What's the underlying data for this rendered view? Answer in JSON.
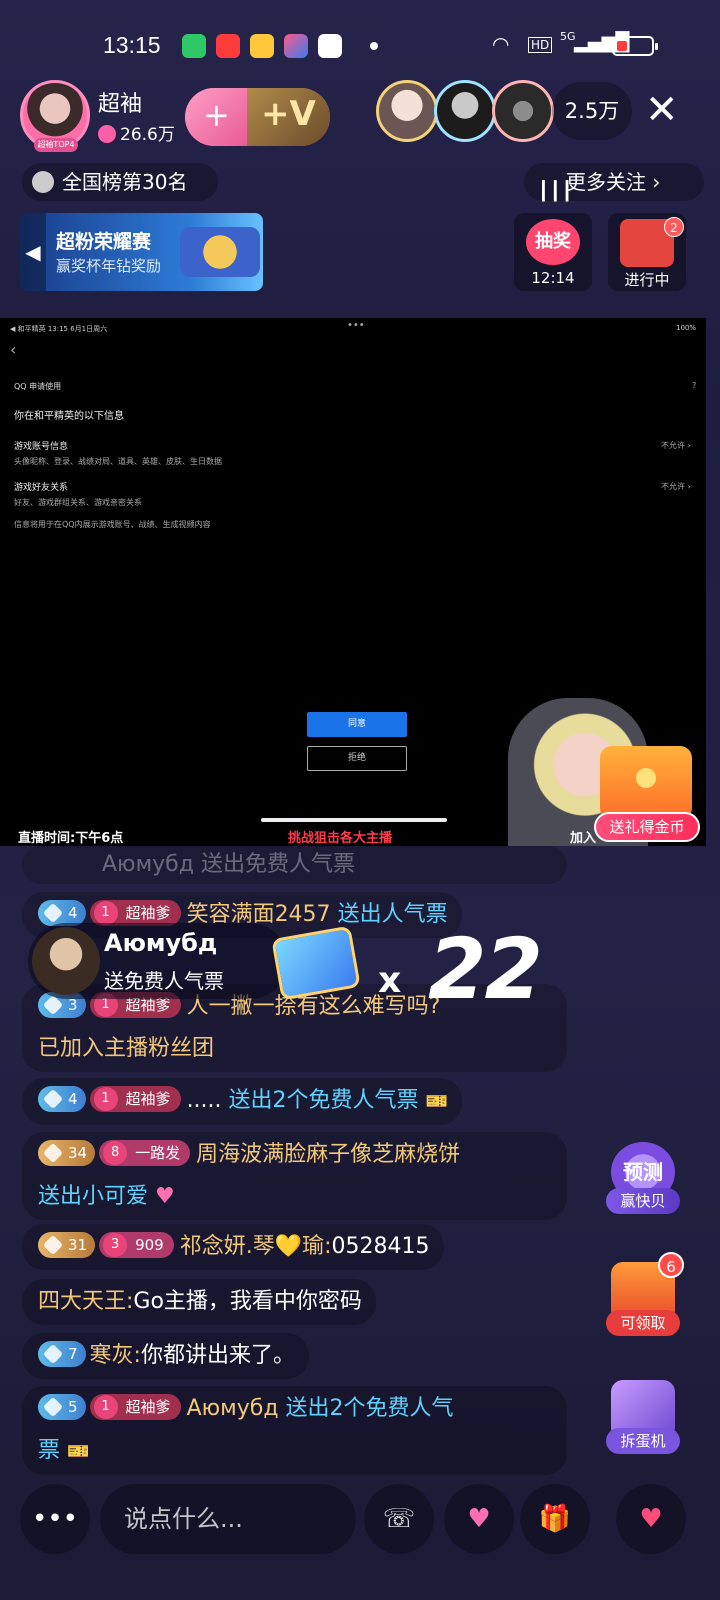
{
  "status_bar": {
    "time": "13:15",
    "hd": "HD",
    "network": "5G"
  },
  "streamer": {
    "name": "超袖",
    "likes": "26.6万",
    "avatar_tag": "超袖TOP4"
  },
  "follow_button": {
    "plus": "+",
    "v": "+V"
  },
  "viewers": {
    "count": "2.5万"
  },
  "close_label": "✕",
  "rank": {
    "label": "全国榜第30名"
  },
  "more_follow": {
    "label": "更多关注 ›"
  },
  "banner": {
    "title": "超粉荣耀赛",
    "subtitle": "赢奖杯年钻奖励",
    "arrow": "◀"
  },
  "lottery": {
    "label": "抽奖",
    "timer": "12:14"
  },
  "in_progress": {
    "label": "进行中",
    "badge": "2"
  },
  "video": {
    "status_left": "◀ 和平精英   13:15  6月1日周六",
    "status_right": "100%",
    "dots": "•••",
    "back": "‹",
    "qq_title": "QQ 申请使用",
    "qq_help": "?",
    "heading": "你在和平精英的以下信息",
    "permissions": [
      {
        "title": "游戏账号信息",
        "desc": "头像昵称、登录、战绩对局、道具、英雄、皮肤、生日数据",
        "state": "不允许 ›"
      },
      {
        "title": "游戏好友关系",
        "desc": "好友、游戏群组关系、游戏亲密关系",
        "state": "不允许 ›"
      }
    ],
    "note": "信息将用于在QQ内展示游戏账号、战绩、生成视频内容",
    "agree": "同意",
    "reject": "拒绝",
    "live_time": "直播时间:下午6点",
    "challenge": "挑战狙击各大主播",
    "join": "加入",
    "gift_coin": "送礼得金币"
  },
  "faded_msg": "Аюмубд  送出免费人气票",
  "chat": [
    {
      "level": "4",
      "fan_level": "1",
      "fan_name": "超袖爹",
      "user": "笑容满面2457",
      "action": "送出人气票",
      "text": ""
    },
    {
      "level": "3",
      "fan_level": "1",
      "fan_name": "超袖爹",
      "user": "",
      "action": "",
      "text": "人一撇一捺有这么难写吗?",
      "text2": "已加入主播粉丝团"
    },
    {
      "level": "4",
      "fan_level": "1",
      "fan_name": "超袖爹",
      "user": ".....",
      "action": "送出2个免费人气票",
      "text": ""
    },
    {
      "level": "34",
      "fan_level": "8",
      "fan_name": "一路发",
      "user": "周海波满脸麻子像芝麻烧饼",
      "action": "送出小可爱",
      "text": ""
    },
    {
      "level": "31",
      "fan_level": "3",
      "fan_name": "909",
      "user": "祁念妍.琴💛瑜:",
      "action": "",
      "text": "0528415"
    },
    {
      "user": "四大天王:",
      "text": "Go主播，我看中你密码"
    },
    {
      "level": "7",
      "user": "寒灰:",
      "text": "你都讲出来了。"
    },
    {
      "level": "5",
      "fan_level": "1",
      "fan_name": "超袖爹",
      "user": "Аюмубд",
      "action": "送出2个免费人气",
      "action2": "票"
    }
  ],
  "gift_toast": {
    "user": "Аюмубд",
    "desc": "送免费人气票",
    "x": "x",
    "count": "22"
  },
  "side": {
    "predict": "预测",
    "predict_tag": "赢快贝",
    "claim_tag": "可领取",
    "claim_badge": "6",
    "egg_tag": "拆蛋机"
  },
  "bottom": {
    "more": "•••",
    "placeholder": "说点什么..."
  },
  "colors": {
    "accent_pink": "#ff4d7b",
    "action_blue": "#5fd3ff",
    "username_gold": "#f2c879"
  }
}
